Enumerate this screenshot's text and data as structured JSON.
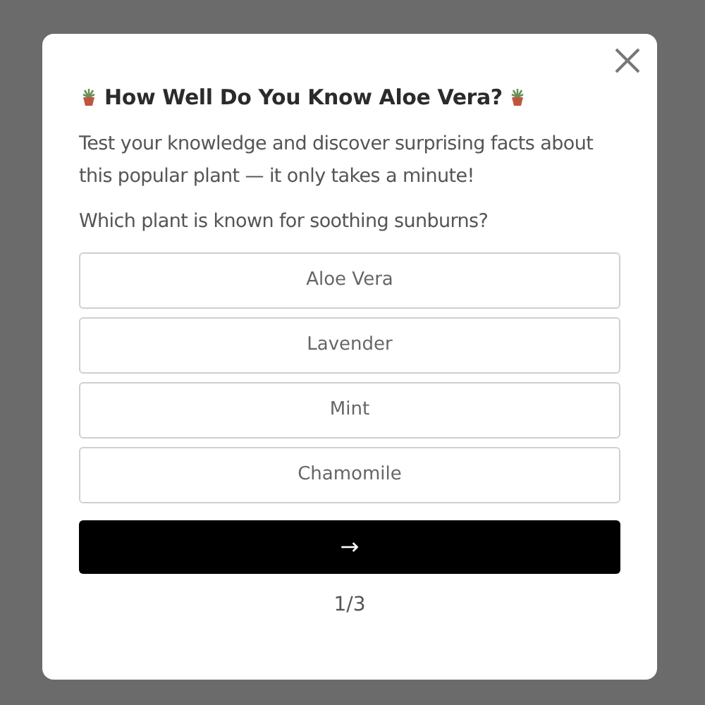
{
  "quiz": {
    "title": "How Well Do You Know Aloe Vera?",
    "intro": "Test your knowledge and discover surprising facts about this popular plant — it only takes a minute!",
    "question": "Which plant is known for soothing sunburns?",
    "options": [
      {
        "label": "Aloe Vera",
        "selected": false
      },
      {
        "label": "Lavender",
        "selected": false
      },
      {
        "label": "Mint",
        "selected": false
      },
      {
        "label": "Chamomile",
        "selected": false
      }
    ],
    "next_button": "→",
    "progress": "1/3"
  }
}
